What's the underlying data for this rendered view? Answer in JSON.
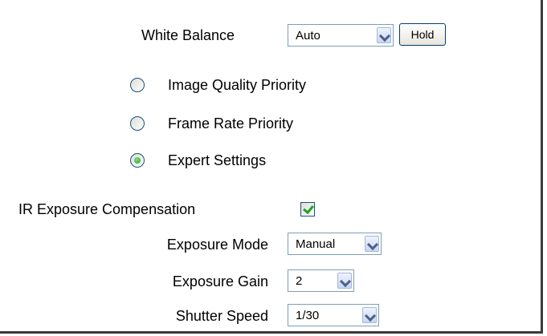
{
  "white_balance": {
    "label": "White Balance",
    "value": "Auto",
    "hold_label": "Hold"
  },
  "priority": {
    "options": [
      {
        "label": "Image Quality Priority",
        "selected": false
      },
      {
        "label": "Frame Rate Priority",
        "selected": false
      },
      {
        "label": "Expert Settings",
        "selected": true
      }
    ]
  },
  "ir_compensation": {
    "label": "IR Exposure Compensation",
    "checked": true
  },
  "exposure_mode": {
    "label": "Exposure Mode",
    "value": "Manual"
  },
  "exposure_gain": {
    "label": "Exposure Gain",
    "value": "2"
  },
  "shutter_speed": {
    "label": "Shutter Speed",
    "value": "1/30"
  },
  "icons": {
    "dropdown": "chevron-down-icon",
    "radio": "radio-icon",
    "checkbox": "checkbox-icon"
  },
  "colors": {
    "accent_check": "#21a121",
    "control_border": "#7f9db9",
    "frame_border": "#3a3a3a"
  }
}
